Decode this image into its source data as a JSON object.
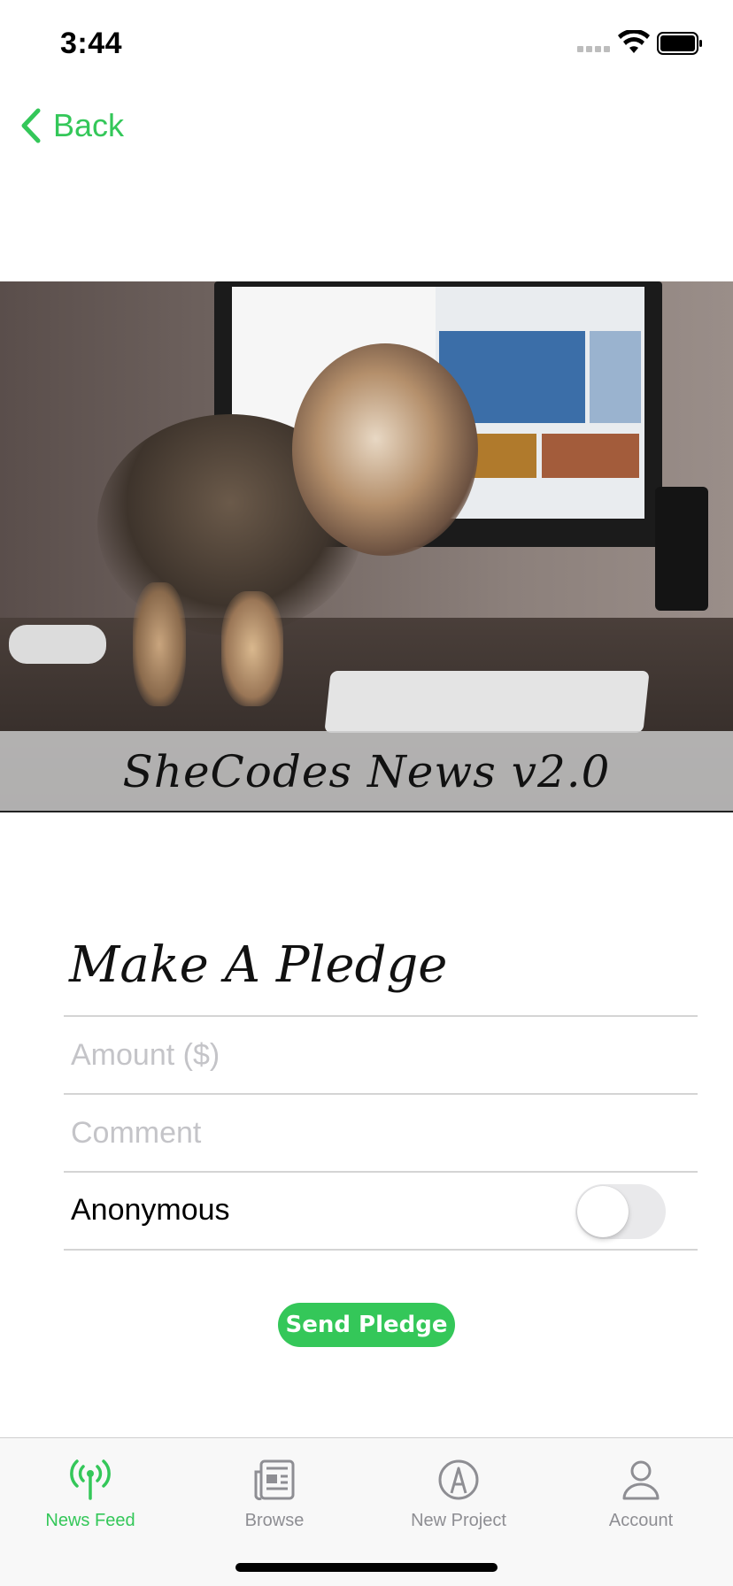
{
  "status_bar": {
    "time": "3:44",
    "icons": [
      "signal-icon",
      "wifi-icon",
      "battery-icon"
    ]
  },
  "nav": {
    "back_label": "Back",
    "back_icon": "chevron-left-icon"
  },
  "hero": {
    "title": "SheCodes News v2.0"
  },
  "pledge_form": {
    "title": "Make A Pledge",
    "amount_placeholder": "Amount ($)",
    "comment_placeholder": "Comment",
    "anonymous_label": "Anonymous",
    "anonymous_on": false,
    "send_label": "Send Pledge"
  },
  "tab_bar": {
    "tabs": [
      {
        "label": "News Feed",
        "icon": "antenna-icon",
        "active": true
      },
      {
        "label": "Browse",
        "icon": "newspaper-icon",
        "active": false
      },
      {
        "label": "New Project",
        "icon": "compass-icon",
        "active": false
      },
      {
        "label": "Account",
        "icon": "person-icon",
        "active": false
      }
    ]
  },
  "colors": {
    "accent": "#34c759",
    "inactive": "#8e8e93",
    "divider": "#d4d4d4"
  }
}
